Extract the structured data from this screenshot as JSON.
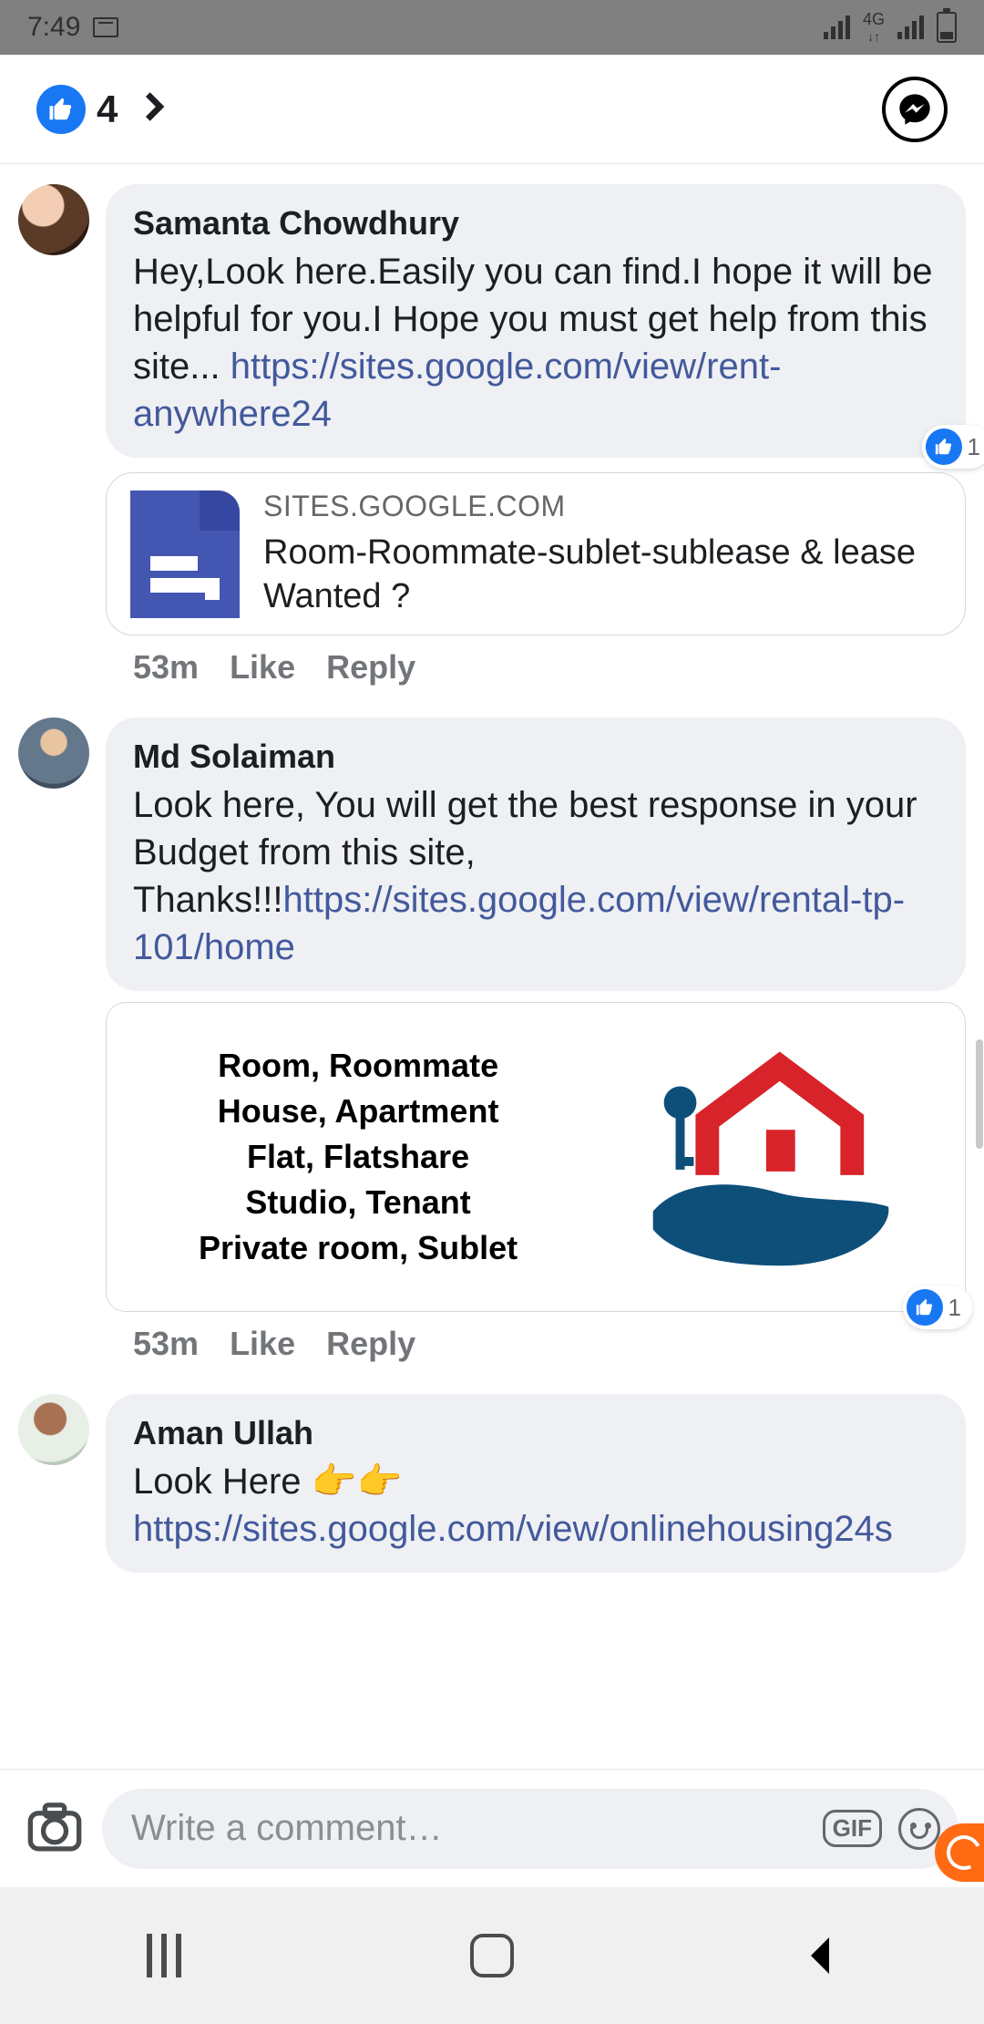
{
  "status_bar": {
    "time": "7:49",
    "network_label": "4G"
  },
  "header": {
    "reaction_count": "4"
  },
  "comments": [
    {
      "author": "Samanta Chowdhury",
      "body_text": "Hey,Look here.Easily you can find.I hope it will be helpful for you.I Hope you must get help from this site... ",
      "body_link": "https://sites.google.com/view/rent-anywhere24",
      "reaction_count": "1",
      "link_card": {
        "domain": "SITES.GOOGLE.COM",
        "title": "Room-Roommate-sublet-sublease & lease Wanted ?"
      },
      "timestamp": "53m",
      "like_label": "Like",
      "reply_label": "Reply"
    },
    {
      "author": "Md Solaiman",
      "body_text": "Look here, You will get the best response in your Budget from this site, Thanks!!!",
      "body_link": "https://sites.google.com/view/rental-tp-101/home",
      "image_card": {
        "line1": "Room, Roommate",
        "line2": "House, Apartment",
        "line3": "Flat, Flatshare",
        "line4": "Studio, Tenant",
        "line5": "Private room, Sublet"
      },
      "reaction_count": "1",
      "timestamp": "53m",
      "like_label": "Like",
      "reply_label": "Reply"
    },
    {
      "author": "Aman Ullah",
      "body_text": "Look Here 👉👉 ",
      "body_link": "https://sites.google.com/view/onlinehousing24s"
    }
  ],
  "composer": {
    "placeholder": "Write a comment…",
    "gif_label": "GIF"
  }
}
